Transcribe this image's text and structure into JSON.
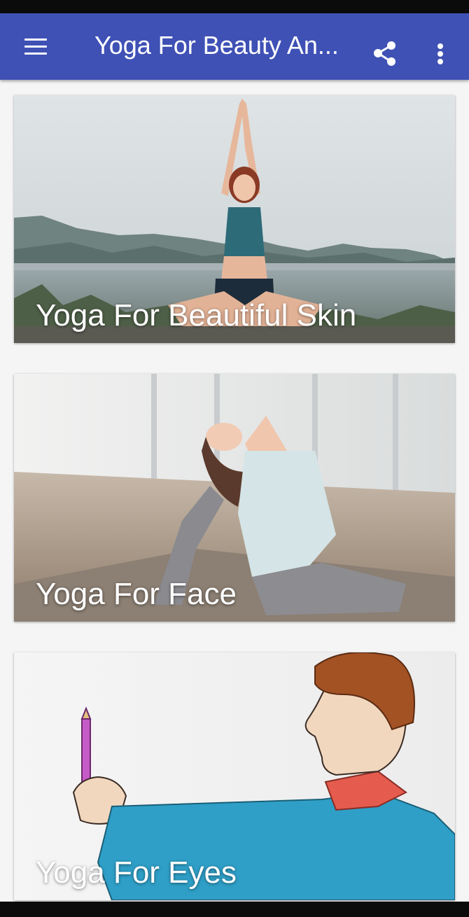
{
  "app_bar": {
    "title": "Yoga For Beauty An...",
    "icons": [
      "menu-icon",
      "share-icon",
      "more-vert-icon"
    ],
    "color": "#3f51b5"
  },
  "cards": [
    {
      "title": "Yoga For Beautiful Skin",
      "image": "woman-meditating-lakeside-photo"
    },
    {
      "title": "Yoga For Face",
      "image": "woman-pigeon-pose-studio-photo"
    },
    {
      "title": "Yoga For Eyes",
      "image": "man-holding-pencil-illustration"
    }
  ]
}
